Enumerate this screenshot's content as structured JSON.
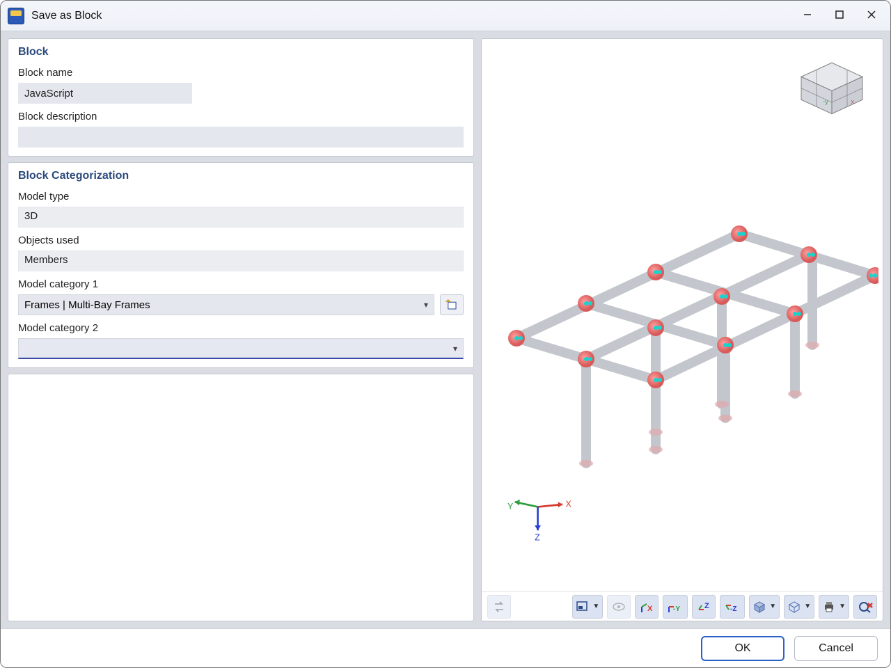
{
  "window": {
    "title": "Save as Block"
  },
  "block_section": {
    "title": "Block",
    "name_label": "Block name",
    "name_value": "JavaScript",
    "desc_label": "Block description",
    "desc_value": ""
  },
  "categorization_section": {
    "title": "Block Categorization",
    "model_type_label": "Model type",
    "model_type_value": "3D",
    "objects_used_label": "Objects used",
    "objects_used_value": "Members",
    "cat1_label": "Model category 1",
    "cat1_value": "Frames | Multi-Bay Frames",
    "cat2_label": "Model category 2",
    "cat2_value": ""
  },
  "preview": {
    "cube": "view-cube",
    "axes": {
      "x": "X",
      "y": "Y",
      "z": "Z"
    },
    "toolbar_icons": [
      "swap-icon",
      "config-dropdown-icon",
      "visibility-icon",
      "axis-x-icon",
      "axis-neg-y-icon",
      "axis-z-icon",
      "axis-neg-z-icon",
      "render-style-icon",
      "wireframe-icon",
      "print-icon",
      "reset-view-icon"
    ]
  },
  "footer": {
    "ok": "OK",
    "cancel": "Cancel"
  },
  "colors": {
    "accent": "#2c62c8",
    "heading": "#2b4a7b"
  }
}
